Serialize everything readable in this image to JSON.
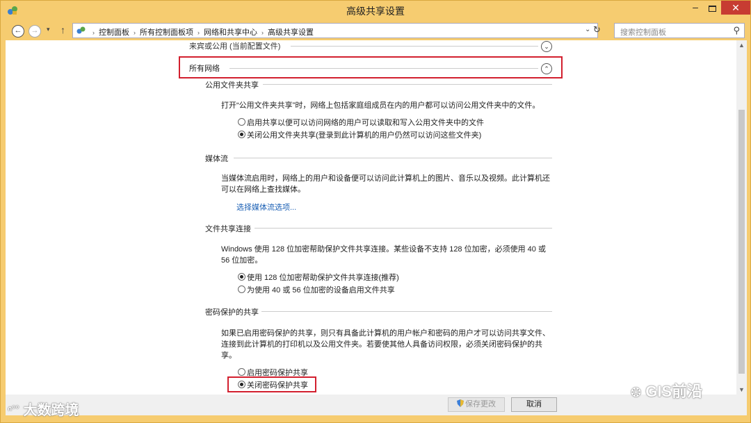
{
  "window": {
    "title": "高级共享设置",
    "min_glyph": "‒",
    "close_glyph": "✕"
  },
  "nav": {
    "back_glyph": "←",
    "forward_glyph": "→",
    "recent_glyph": "▾",
    "up_glyph": "↑",
    "breadcrumbs": [
      "控制面板",
      "所有控制面板项",
      "网络和共享中心",
      "高级共享设置"
    ],
    "sep": "›",
    "dropdown_glyph": "⌄",
    "refresh_glyph": "↻",
    "search_placeholder": "搜索控制面板",
    "search_glyph": "⚲"
  },
  "sections": {
    "guest_public": {
      "label": "来宾或公用 (当前配置文件)",
      "toggle_glyph": "⌄"
    },
    "all_networks": {
      "label": "所有网络",
      "toggle_glyph": "⌃"
    }
  },
  "public_folder": {
    "header": "公用文件夹共享",
    "desc": "打开“公用文件夹共享”时，网络上包括家庭组成员在内的用户都可以访问公用文件夹中的文件。",
    "option_on": "启用共享以便可以访问网络的用户可以读取和写入公用文件夹中的文件",
    "option_off": "关闭公用文件夹共享(登录到此计算机的用户仍然可以访问这些文件夹)",
    "selected": "off"
  },
  "media": {
    "header": "媒体流",
    "desc_line1": "当媒体流启用时，网络上的用户和设备便可以访问此计算机上的图片、音乐以及视频。此计算机还",
    "desc_line2": "可以在网络上查找媒体。",
    "link": "选择媒体流选项..."
  },
  "file_sharing": {
    "header": "文件共享连接",
    "desc_line1": "Windows 使用 128 位加密帮助保护文件共享连接。某些设备不支持 128 位加密，必须使用 40 或",
    "desc_line2": "56 位加密。",
    "option_128": "使用 128 位加密帮助保护文件共享连接(推荐)",
    "option_40_56": "为使用 40 或 56 位加密的设备启用文件共享",
    "selected": "128"
  },
  "password": {
    "header": "密码保护的共享",
    "desc_line1": "如果已启用密码保护的共享，则只有具备此计算机的用户帐户和密码的用户才可以访问共享文件、",
    "desc_line2": "连接到此计算机的打印机以及公用文件夹。若要使其他人具备访问权限，必须关闭密码保护的共",
    "desc_line3": "享。",
    "option_on": "启用密码保护共享",
    "option_off": "关闭密码保护共享",
    "selected": "off"
  },
  "buttons": {
    "save": "保存更改",
    "cancel": "取消"
  },
  "scroll": {
    "up_glyph": "▲",
    "down_glyph": "▼"
  },
  "watermarks": {
    "left": "大数跨境",
    "right": "GIS前沿"
  },
  "colors": {
    "frame": "#f6cc70",
    "highlight": "#d21f2e",
    "link": "#1a5fb4",
    "close": "#c73c32"
  }
}
